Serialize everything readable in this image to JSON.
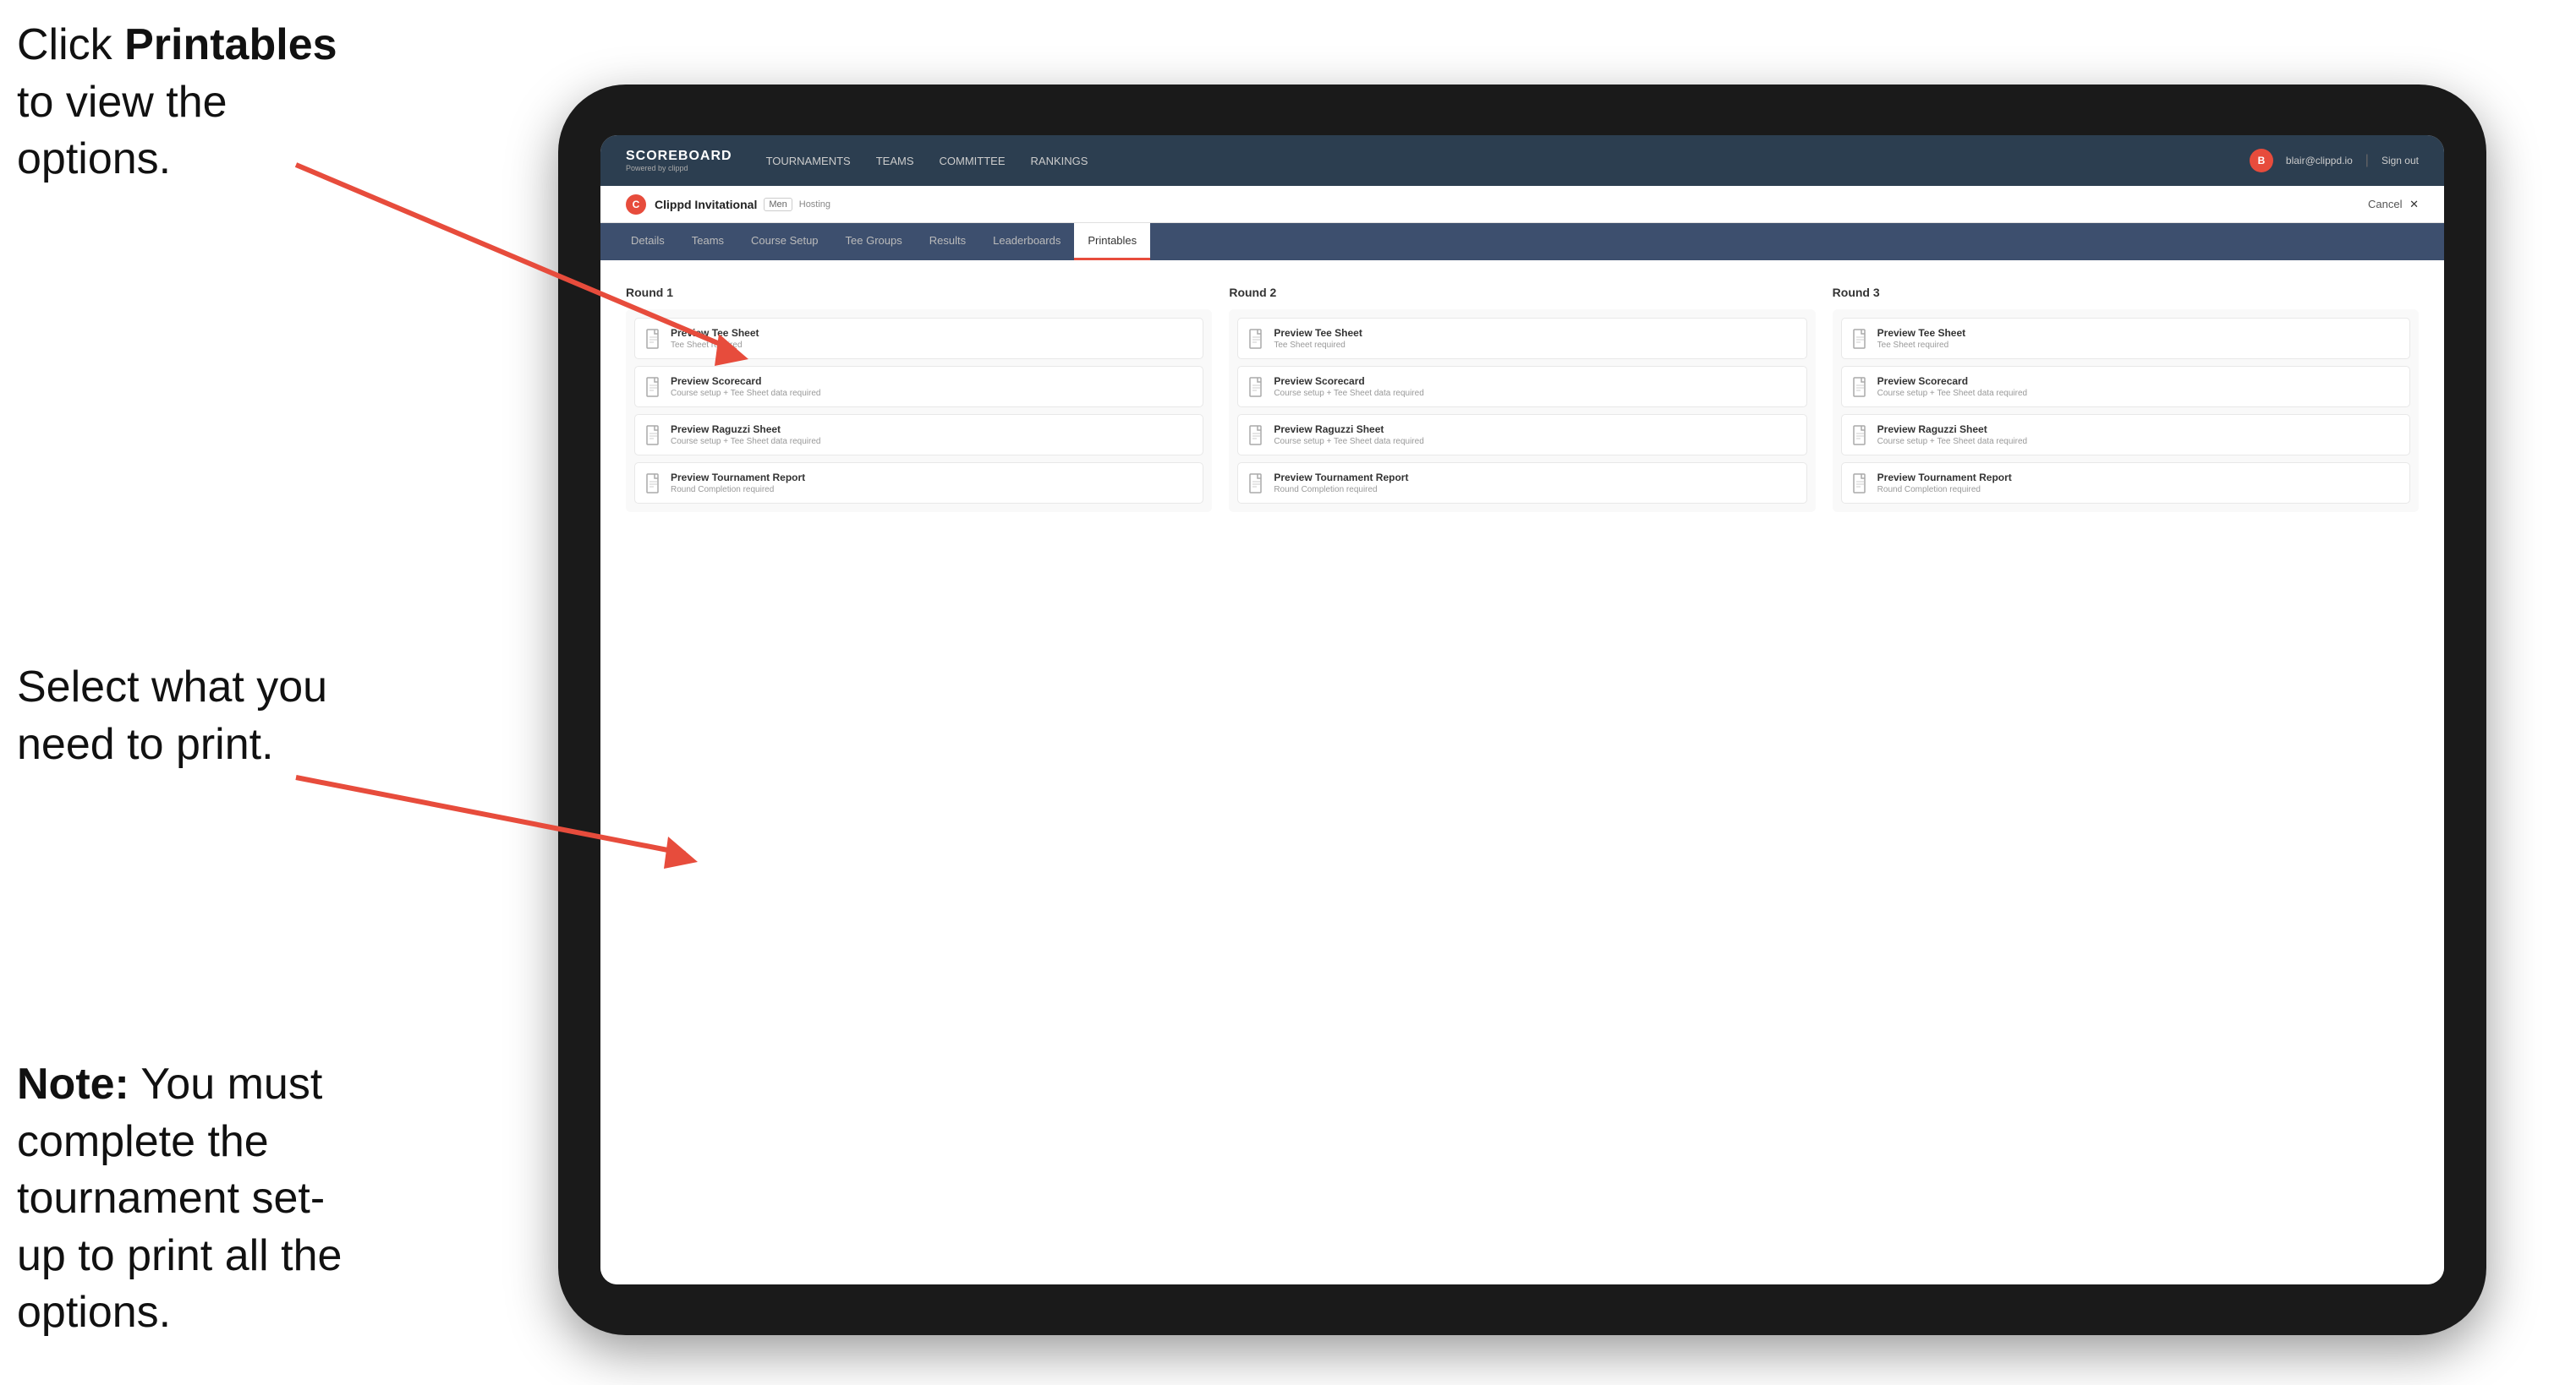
{
  "instructions": {
    "top": {
      "prefix": "Click ",
      "bold": "Printables",
      "suffix": " to view the options."
    },
    "mid": "Select what you need to print.",
    "bottom": {
      "prefix_bold": "Note:",
      "suffix": " You must complete the tournament set-up to print all the options."
    }
  },
  "nav": {
    "brand_title": "SCOREBOARD",
    "brand_subtitle": "Powered by clippd",
    "links": [
      "TOURNAMENTS",
      "TEAMS",
      "COMMITTEE",
      "RANKINGS"
    ],
    "user_avatar": "B",
    "user_email": "blair@clippd.io",
    "sign_out": "Sign out"
  },
  "tournament": {
    "logo_letter": "C",
    "name": "Clippd Invitational",
    "badge": "Men",
    "hosting": "Hosting",
    "cancel": "Cancel"
  },
  "tabs": [
    "Details",
    "Teams",
    "Course Setup",
    "Tee Groups",
    "Results",
    "Leaderboards",
    "Printables"
  ],
  "active_tab": "Printables",
  "rounds": [
    {
      "title": "Round 1",
      "cards": [
        {
          "icon": "file",
          "title": "Preview Tee Sheet",
          "subtitle": "Tee Sheet required"
        },
        {
          "icon": "file",
          "title": "Preview Scorecard",
          "subtitle": "Course setup + Tee Sheet data required"
        },
        {
          "icon": "file",
          "title": "Preview Raguzzi Sheet",
          "subtitle": "Course setup + Tee Sheet data required"
        },
        {
          "icon": "file",
          "title": "Preview Tournament Report",
          "subtitle": "Round Completion required"
        }
      ]
    },
    {
      "title": "Round 2",
      "cards": [
        {
          "icon": "file",
          "title": "Preview Tee Sheet",
          "subtitle": "Tee Sheet required"
        },
        {
          "icon": "file",
          "title": "Preview Scorecard",
          "subtitle": "Course setup + Tee Sheet data required"
        },
        {
          "icon": "file",
          "title": "Preview Raguzzi Sheet",
          "subtitle": "Course setup + Tee Sheet data required"
        },
        {
          "icon": "file",
          "title": "Preview Tournament Report",
          "subtitle": "Round Completion required"
        }
      ]
    },
    {
      "title": "Round 3",
      "cards": [
        {
          "icon": "file",
          "title": "Preview Tee Sheet",
          "subtitle": "Tee Sheet required"
        },
        {
          "icon": "file",
          "title": "Preview Scorecard",
          "subtitle": "Course setup + Tee Sheet data required"
        },
        {
          "icon": "file",
          "title": "Preview Raguzzi Sheet",
          "subtitle": "Course setup + Tee Sheet data required"
        },
        {
          "icon": "file",
          "title": "Preview Tournament Report",
          "subtitle": "Round Completion required"
        }
      ]
    }
  ],
  "colors": {
    "accent": "#e74c3c",
    "nav_bg": "#2c3e50",
    "tab_bg": "#3d4f6e"
  }
}
